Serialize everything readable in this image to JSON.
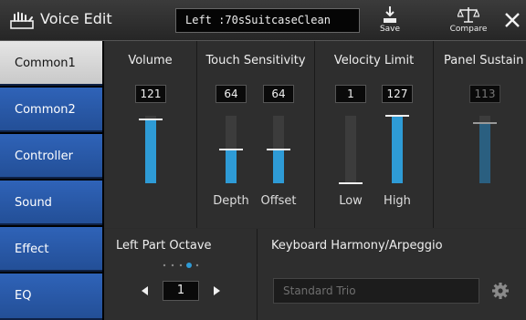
{
  "header": {
    "title": "Voice Edit",
    "voice_part": "Left",
    "voice_name": ":70sSuitcaseClean",
    "save_label": "Save",
    "compare_label": "Compare"
  },
  "sidebar": {
    "tabs": [
      "Common1",
      "Common2",
      "Controller",
      "Sound",
      "Effect",
      "EQ"
    ],
    "active": "Common1"
  },
  "panels": {
    "volume": {
      "title": "Volume",
      "value": "121",
      "level": 0.95
    },
    "touch_sensitivity": {
      "title": "Touch Sensitivity",
      "depth": {
        "label": "Depth",
        "value": "64",
        "level": 0.5
      },
      "offset": {
        "label": "Offset",
        "value": "64",
        "level": 0.5
      }
    },
    "velocity_limit": {
      "title": "Velocity Limit",
      "low": {
        "label": "Low",
        "value": "1",
        "level": 0.0
      },
      "high": {
        "label": "High",
        "value": "127",
        "level": 1.0
      }
    },
    "panel_sustain": {
      "title": "Panel Sustain",
      "value": "113",
      "level": 0.89,
      "disabled": true
    }
  },
  "left_part_octave": {
    "title": "Left Part Octave",
    "value": "1"
  },
  "harmony": {
    "title": "Keyboard Harmony/Arpeggio",
    "value": "Standard Trio"
  },
  "colors": {
    "accent": "#2e9bd6",
    "tab": "#2a5aa8",
    "active_tab": "#d8d8d8"
  }
}
